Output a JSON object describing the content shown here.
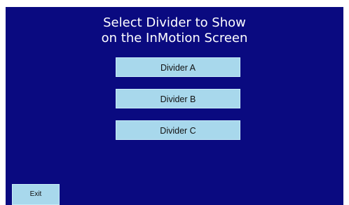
{
  "screen": {
    "background_color": "#0a0a80",
    "title_line1": "Select Divider to Show",
    "title_line2": "on the InMotion Screen"
  },
  "buttons": {
    "divider_a": "Divider A",
    "divider_b": "Divider B",
    "divider_c": "Divider C",
    "exit": "Exit",
    "button_color": "#a8d8ec"
  }
}
